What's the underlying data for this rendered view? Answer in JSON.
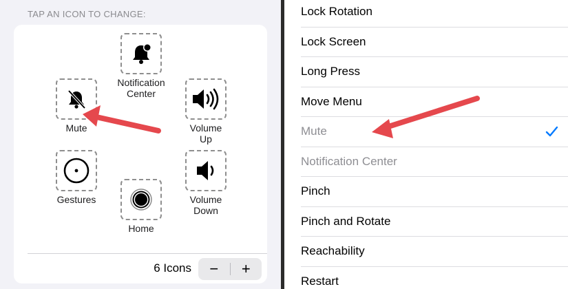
{
  "left": {
    "section_header": "TAP AN ICON TO CHANGE:",
    "icons": {
      "notification_center": "Notification\nCenter",
      "mute": "Mute",
      "volume_up": "Volume\nUp",
      "gestures": "Gestures",
      "volume_down": "Volume\nDown",
      "home": "Home"
    },
    "count_label": "6 Icons",
    "decrement_label": "−",
    "increment_label": "+"
  },
  "right": {
    "items": [
      {
        "label": "Lock Rotation",
        "state": "normal"
      },
      {
        "label": "Lock Screen",
        "state": "normal"
      },
      {
        "label": "Long Press",
        "state": "normal"
      },
      {
        "label": "Move Menu",
        "state": "normal"
      },
      {
        "label": "Mute",
        "state": "disabled-selected"
      },
      {
        "label": "Notification Center",
        "state": "disabled"
      },
      {
        "label": "Pinch",
        "state": "normal"
      },
      {
        "label": "Pinch and Rotate",
        "state": "normal"
      },
      {
        "label": "Reachability",
        "state": "normal"
      },
      {
        "label": "Restart",
        "state": "normal"
      }
    ]
  },
  "colors": {
    "accent": "#007aff",
    "annotation_arrow": "#e5484d",
    "disabled_text": "#8e8e93"
  },
  "icons": [
    "bell-badge-icon",
    "bell-slash-icon",
    "speaker-loud-icon",
    "circle-dot-icon",
    "speaker-low-icon",
    "home-button-icon",
    "checkmark-icon"
  ]
}
